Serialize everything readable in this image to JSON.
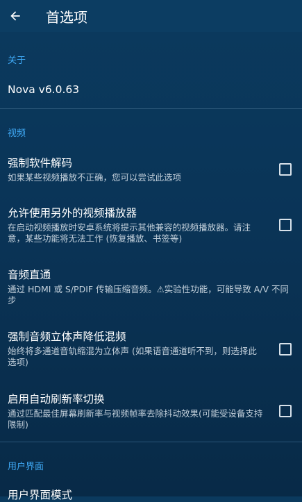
{
  "appbar": {
    "title": "首选项",
    "back_icon": "arrow-left-icon"
  },
  "sections": {
    "about": {
      "header": "关于",
      "version": "Nova v6.0.63"
    },
    "video": {
      "header": "视频",
      "items": [
        {
          "title": "强制软件解码",
          "summary": "如果某些视频播放不正确，您可以尝试此选项",
          "checked": false
        },
        {
          "title": "允许使用另外的视频播放器",
          "summary": "在启动视频播放时安卓系统将提示其他兼容的视频播放器。请注意，某些功能将无法工作 (恢复播放、书签等)",
          "checked": false
        },
        {
          "title": "音频直通",
          "summary": "通过 HDMI 或 S/PDIF 传输压缩音频。⚠实验性功能，可能导致 A/V 不同步"
        },
        {
          "title": "强制音频立体声降低混频",
          "summary": "始终将多通道音轨缩混为立体声 (如果语音通道听不到，则选择此选项)",
          "checked": false
        },
        {
          "title": "启用自动刷新率切换",
          "summary": "通过匹配最佳屏幕刷新率与视频帧率去除抖动效果(可能受设备支持限制)",
          "checked": false
        }
      ]
    },
    "ui": {
      "header": "用户界面",
      "partial_item_title": "用户界面模式"
    }
  },
  "colors": {
    "accent": "#3fa9f5",
    "background": "#0a3457",
    "divider": "#2a5678"
  }
}
